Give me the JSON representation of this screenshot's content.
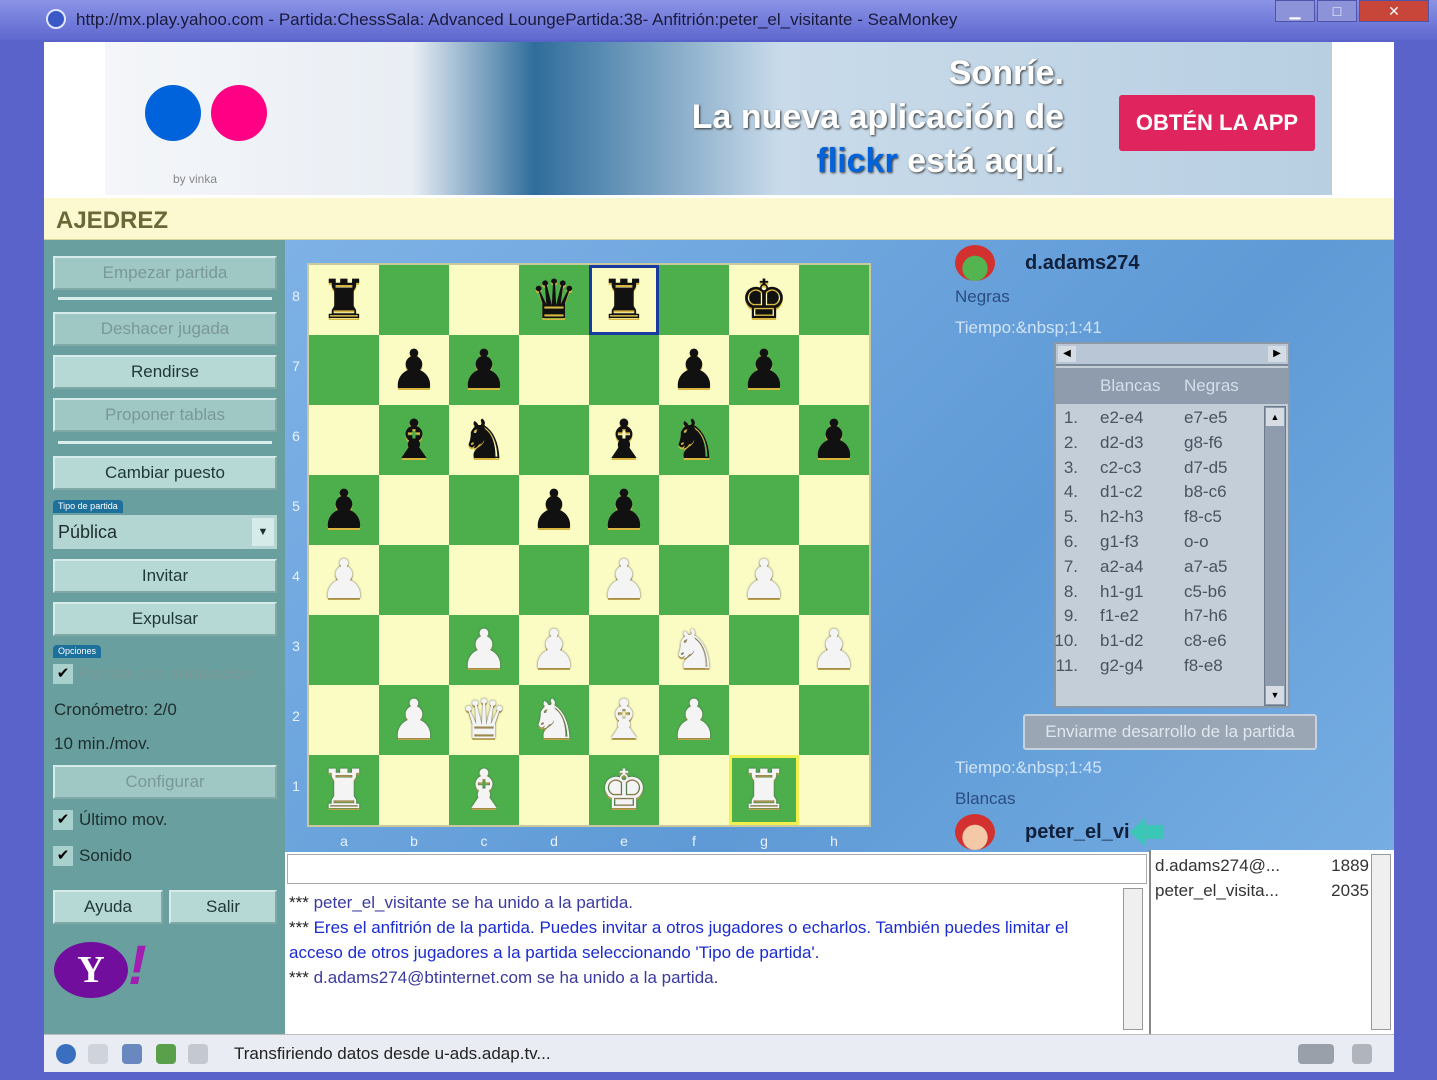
{
  "window": {
    "title": "http://mx.play.yahoo.com - Partida:ChessSala: Advanced LoungePartida:38- Anfitrión:peter_el_visitante - SeaMonkey",
    "controls": [
      "minimize",
      "maximize",
      "close"
    ]
  },
  "ad": {
    "byline": "by vinka",
    "line1": "Sonríe.",
    "line2": "La nueva aplicación de",
    "brand": "flickr",
    "line3": "está aquí.",
    "cta": "OBTÉN LA APP",
    "colors": {
      "blue": "#0063dc",
      "pink": "#ff0084"
    }
  },
  "section_title": "AJEDREZ",
  "left": {
    "buttons": {
      "start": "Empezar partida",
      "undo": "Deshacer jugada",
      "resign": "Rendirse",
      "draw": "Proponer tablas",
      "switch": "Cambiar puesto",
      "invite": "Invitar",
      "kick": "Expulsar",
      "configure": "Configurar",
      "help": "Ayuda",
      "exit": "Salir"
    },
    "game_type_label": "Tipo de partida",
    "game_type_value": "Pública",
    "options_label": "Opciones",
    "rated": "Partida con puntuación",
    "clock": "Cronómetro: 2/0",
    "per_move": "10 min./mov.",
    "last_move": "Último mov.",
    "sound": "Sonido",
    "logo": "Y!"
  },
  "board": {
    "ranks": [
      "8",
      "7",
      "6",
      "5",
      "4",
      "3",
      "2",
      "1"
    ],
    "files": [
      "a",
      "b",
      "c",
      "d",
      "e",
      "f",
      "g",
      "h"
    ],
    "rows": [
      "r..qr.k.",
      ".pp..pp.",
      ".bn.bn.p",
      "p..pp...",
      "P...P.P.",
      "..PP.N.P",
      ".PQNBP..",
      "R.B.K.R."
    ],
    "selected": "e8",
    "last_move": "g1"
  },
  "black": {
    "name": "d.adams274",
    "side": "Negras",
    "time": "Tiempo:&nbsp;1:41"
  },
  "white": {
    "name": "peter_el_vi",
    "side": "Blancas",
    "time": "Tiempo:&nbsp;1:45"
  },
  "moves": {
    "headers": [
      "Blancas",
      "Negras"
    ],
    "list": [
      [
        "1.",
        "e2-e4",
        "e7-e5"
      ],
      [
        "2.",
        "d2-d3",
        "g8-f6"
      ],
      [
        "3.",
        "c2-c3",
        "d7-d5"
      ],
      [
        "4.",
        "d1-c2",
        "b8-c6"
      ],
      [
        "5.",
        "h2-h3",
        "f8-c5"
      ],
      [
        "6.",
        "g1-f3",
        "o-o"
      ],
      [
        "7.",
        "a2-a4",
        "a7-a5"
      ],
      [
        "8.",
        "h1-g1",
        "c5-b6"
      ],
      [
        "9.",
        "f1-e2",
        "h7-h6"
      ],
      [
        "10.",
        "b1-d2",
        "c8-e6"
      ],
      [
        "11.",
        "g2-g4",
        "f8-e8"
      ]
    ],
    "send": "Enviarme desarrollo de la partida"
  },
  "chat": {
    "input": "",
    "lines": [
      {
        "prefix": "***",
        "text": "peter_el_visitante se ha unido a la partida.",
        "cls": "msg"
      },
      {
        "prefix": "***",
        "text": "Eres el anfitrión de la partida. Puedes invitar a otros jugadores o echarlos. También puedes limitar el acceso de otros jugadores a la partida seleccionando 'Tipo de partida'.",
        "cls": "sys"
      },
      {
        "prefix": "***",
        "text": "d.adams274@btinternet.com se ha unido a la partida.",
        "cls": "msg"
      }
    ]
  },
  "users": [
    {
      "name": "d.adams274@...",
      "rating": "1889"
    },
    {
      "name": "peter_el_visita...",
      "rating": "2035"
    }
  ],
  "status": {
    "text": "Transfiriendo datos desde u-ads.adap.tv..."
  }
}
